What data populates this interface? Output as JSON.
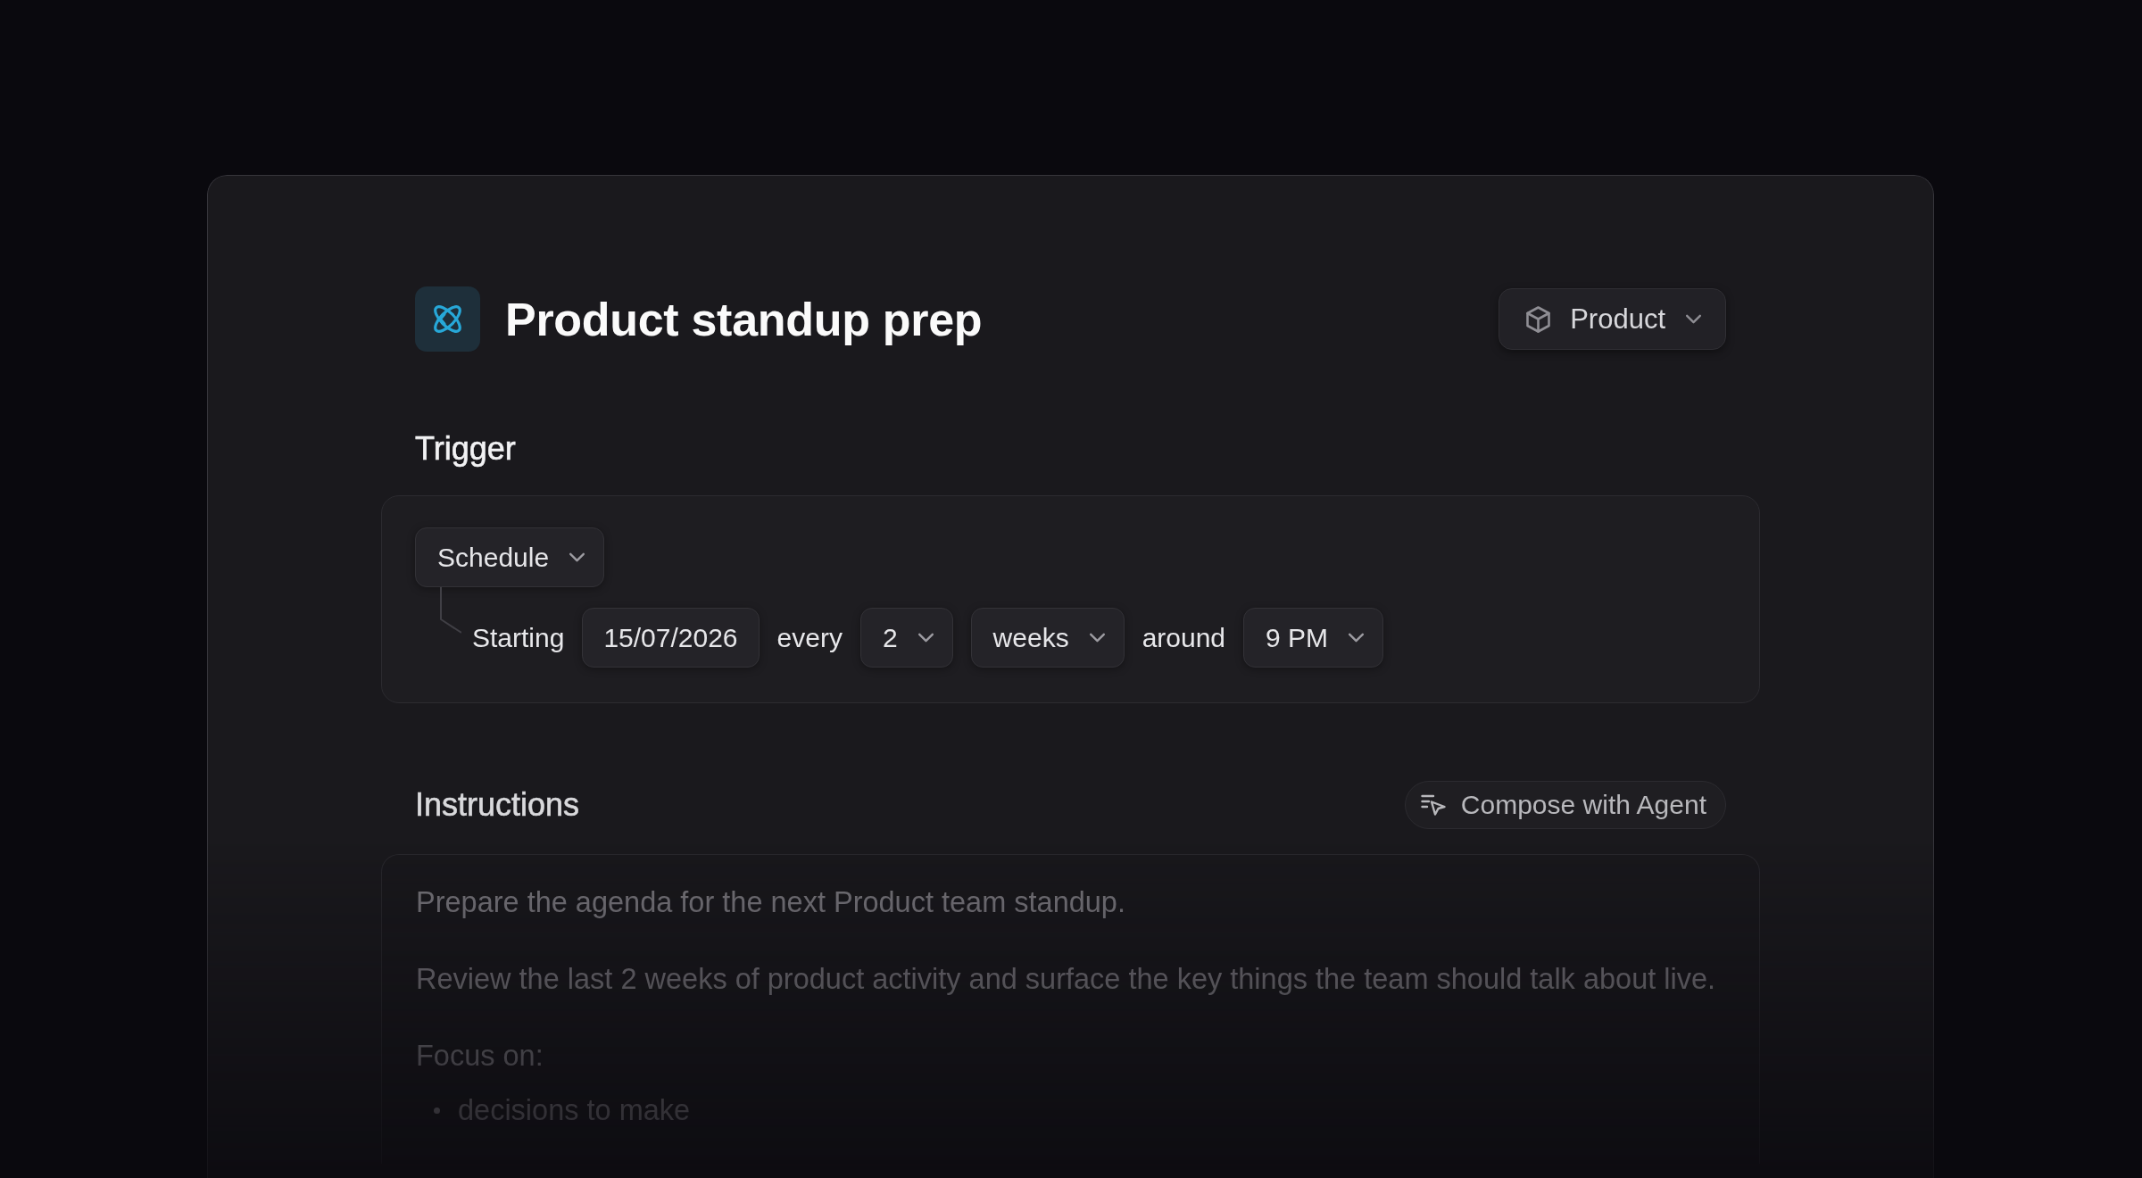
{
  "header": {
    "title": "Product standup prep",
    "project_dropdown": {
      "label": "Product"
    }
  },
  "trigger": {
    "heading": "Trigger",
    "type_dropdown": {
      "value": "Schedule"
    },
    "schedule": [
      {
        "kind": "text",
        "text": "Starting"
      },
      {
        "kind": "field",
        "value": "15/07/2026"
      },
      {
        "kind": "text",
        "text": "every"
      },
      {
        "kind": "dropdown",
        "value": "2"
      },
      {
        "kind": "dropdown",
        "value": "weeks"
      },
      {
        "kind": "text",
        "text": "around"
      },
      {
        "kind": "dropdown",
        "value": "9 PM"
      }
    ]
  },
  "instructions": {
    "heading": "Instructions",
    "compose_button": {
      "label": "Compose with Agent"
    },
    "content": [
      {
        "kind": "paragraph",
        "text": "Prepare the agenda for the next Product team standup."
      },
      {
        "kind": "paragraph",
        "text": "Review the last 2 weeks of product activity and surface the key things the team should talk about live."
      },
      {
        "kind": "paragraph",
        "text": "Focus on:"
      },
      {
        "kind": "bullets",
        "items": [
          "decisions to make"
        ]
      }
    ]
  }
}
